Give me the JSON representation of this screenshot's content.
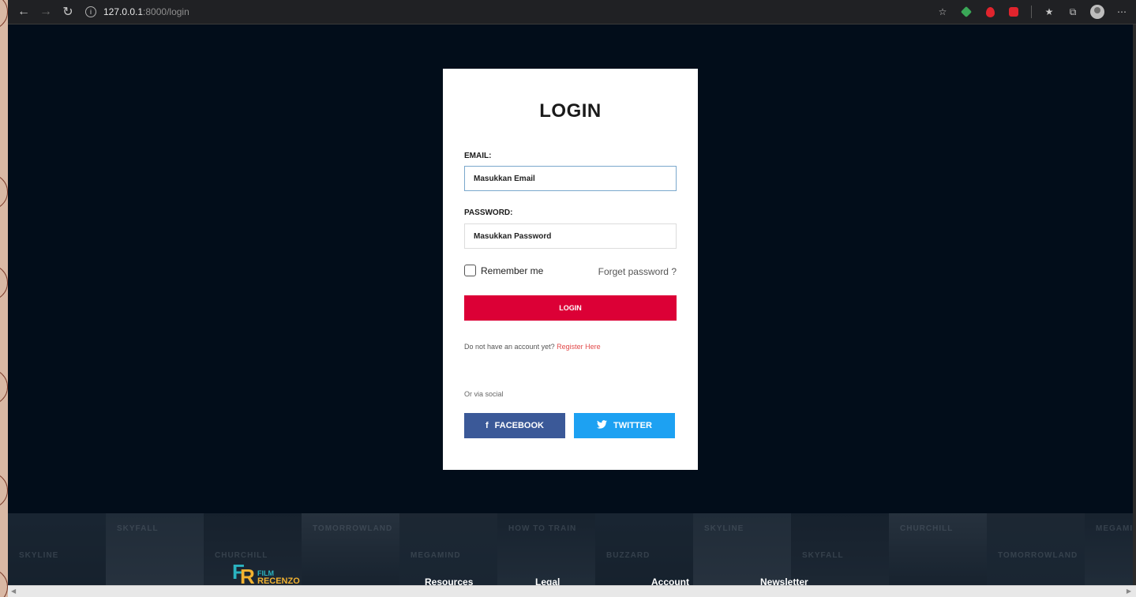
{
  "browser": {
    "url_host": "127.0.0.1",
    "url_path": ":8000/login"
  },
  "login": {
    "title": "LOGIN",
    "email_label": "EMAIL:",
    "email_value": "Masukkan Email",
    "password_label": "PASSWORD:",
    "password_value": "Masukkan Password",
    "remember_label": "Remember me",
    "forgot_label": "Forget password ?",
    "submit_label": "LOGIN",
    "register_prompt": "Do not have an account yet?",
    "register_link": "Register Here",
    "social_label": "Or via social",
    "facebook_label": "FACEBOOK",
    "twitter_label": "TWITTER",
    "facebook_icon": "f"
  },
  "footer": {
    "logo_film": "FILM",
    "logo_recenzo": "RECENZO",
    "links": [
      "Resources",
      "Legal",
      "Account",
      "Newsletter"
    ],
    "posters": [
      "SKYLINE",
      "SKYFALL",
      "CHURCHILL",
      "TOMORROWLAND",
      "MEGAMIND",
      "HOW TO TRAIN",
      "BUZZARD",
      "SKYLINE",
      "SKYFALL",
      "CHURCHILL",
      "TOMORROWLAND",
      "MEGAMIND"
    ]
  },
  "colors": {
    "page_bg": "#020d1a",
    "login_button": "#dc0036",
    "facebook": "#3b5998",
    "twitter": "#1da1f2",
    "register_link": "#e24a4a"
  }
}
